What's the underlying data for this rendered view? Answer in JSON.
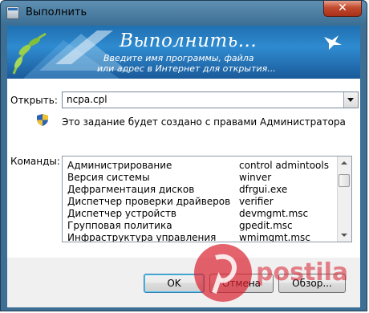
{
  "window": {
    "title": "Выполнить",
    "close_glyph": "✕"
  },
  "banner": {
    "title": "Выполнить...",
    "subtitle_line1": "Введите имя программы, файла",
    "subtitle_line2": "или адрес в Интернет для открытия..."
  },
  "open_field": {
    "label": "Открыть:",
    "value": "ncpa.cpl"
  },
  "admin_note": "Это задание будет создано с правами Администратора",
  "commands": {
    "label": "Команды:",
    "rows": [
      {
        "name": "Администрирование",
        "command": "control admintools"
      },
      {
        "name": "Версия системы",
        "command": "winver"
      },
      {
        "name": "Дефрагментация дисков",
        "command": "dfrgui.exe"
      },
      {
        "name": "Диспетчер проверки драйверов",
        "command": "verifier"
      },
      {
        "name": "Диспетчер устройств",
        "command": "devmgmt.msc"
      },
      {
        "name": "Групповая политика",
        "command": "gpedit.msc"
      },
      {
        "name": "Инфраструктура управления",
        "command": "wmimgmt.msc"
      }
    ]
  },
  "buttons": {
    "ok": "OK",
    "cancel": "Отмена",
    "browse": "Обзор..."
  },
  "colors": {
    "banner": "#2f8bd0",
    "titlebar": "#3c6f94",
    "close": "#c24a2e",
    "ok_focus": "#48c8f2",
    "watermark": "#d8212f"
  },
  "icons": [
    "run-app-icon",
    "close-icon",
    "dropdown-arrow-icon",
    "uac-shield-icon",
    "scroll-up-icon",
    "scroll-down-icon",
    "bird-icon",
    "pin-watermark"
  ]
}
